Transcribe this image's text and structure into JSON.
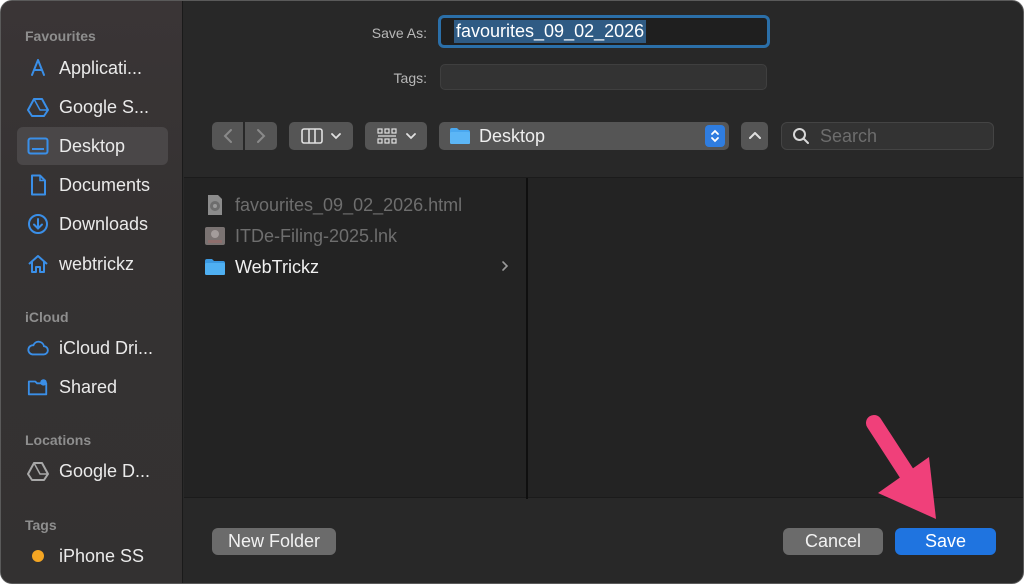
{
  "sidebar": {
    "sections": {
      "favourites": "Favourites",
      "icloud": "iCloud",
      "locations": "Locations",
      "tags": "Tags"
    },
    "items": [
      {
        "label": "Applicati...",
        "icon": "applications-icon"
      },
      {
        "label": "Google S...",
        "icon": "google-drive-icon"
      },
      {
        "label": "Desktop",
        "icon": "desktop-icon",
        "selected": true
      },
      {
        "label": "Documents",
        "icon": "document-icon"
      },
      {
        "label": "Downloads",
        "icon": "download-icon"
      },
      {
        "label": "webtrickz",
        "icon": "home-icon"
      },
      {
        "label": "iCloud Dri...",
        "icon": "cloud-icon"
      },
      {
        "label": "Shared",
        "icon": "shared-folder-icon"
      },
      {
        "label": "Google D...",
        "icon": "drive-location-icon"
      },
      {
        "label": "iPhone SS",
        "icon": "tag-dot-icon",
        "tag_color": "#f5a623"
      }
    ]
  },
  "form": {
    "save_as_label": "Save As:",
    "save_as_value": "favourites_09_02_2026",
    "tags_label": "Tags:",
    "tags_value": ""
  },
  "toolbar": {
    "location": "Desktop",
    "search_placeholder": "Search"
  },
  "files": [
    {
      "name": "favourites_09_02_2026.html",
      "icon": "chrome-html-file-icon",
      "enabled": false
    },
    {
      "name": "ITDe-Filing-2025.lnk",
      "icon": "shortcut-file-icon",
      "enabled": false
    },
    {
      "name": "WebTrickz",
      "icon": "folder-icon",
      "enabled": true,
      "has_children": true
    }
  ],
  "buttons": {
    "new_folder": "New Folder",
    "cancel": "Cancel",
    "save": "Save"
  },
  "colors": {
    "accent": "#1f74e0",
    "folder": "#4aa8f0",
    "annotation_arrow": "#f0407a"
  }
}
